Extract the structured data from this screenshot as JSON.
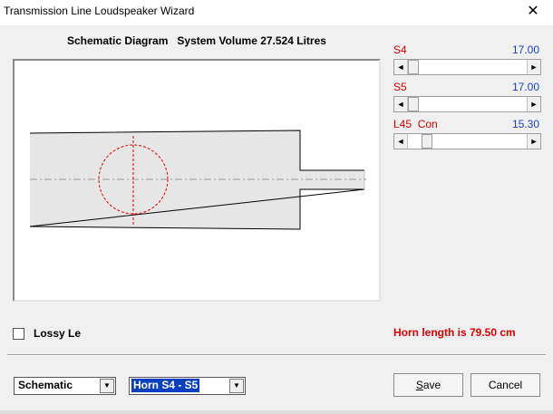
{
  "window": {
    "title": "Transmission Line Loudspeaker Wizard",
    "close_glyph": "✕"
  },
  "diagram": {
    "heading": "Schematic Diagram",
    "volume_text": "System Volume 27.524 Litres"
  },
  "parameters": [
    {
      "label": "S4",
      "value": "17.00",
      "slider_fraction": 0.0
    },
    {
      "label": "S5",
      "value": "17.00",
      "slider_fraction": 0.0
    },
    {
      "label": "L45  Con",
      "value": "15.30",
      "slider_fraction": 0.13
    }
  ],
  "scroll_arrows": {
    "left": "◄",
    "right": "►"
  },
  "lossy": {
    "label": "Lossy Le",
    "checked": false
  },
  "horn_length_text": "Horn length is 79.50 cm",
  "view_select": {
    "value": "Schematic",
    "arrow": "▼"
  },
  "section_select": {
    "value": "Horn S4 - S5",
    "arrow": "▼"
  },
  "buttons": {
    "save_first": "S",
    "save_rest": "ave",
    "cancel": "Cancel"
  },
  "colors": {
    "param_label": "#d40000",
    "param_value": "#1b3fc4",
    "horn_length": "#e00000",
    "selection": "#0a3fbf",
    "driver_outline": "#e00000"
  },
  "icons": {
    "close": "close-icon",
    "scroll_left": "arrow-left-icon",
    "scroll_right": "arrow-right-icon",
    "dropdown": "chevron-down-icon"
  }
}
